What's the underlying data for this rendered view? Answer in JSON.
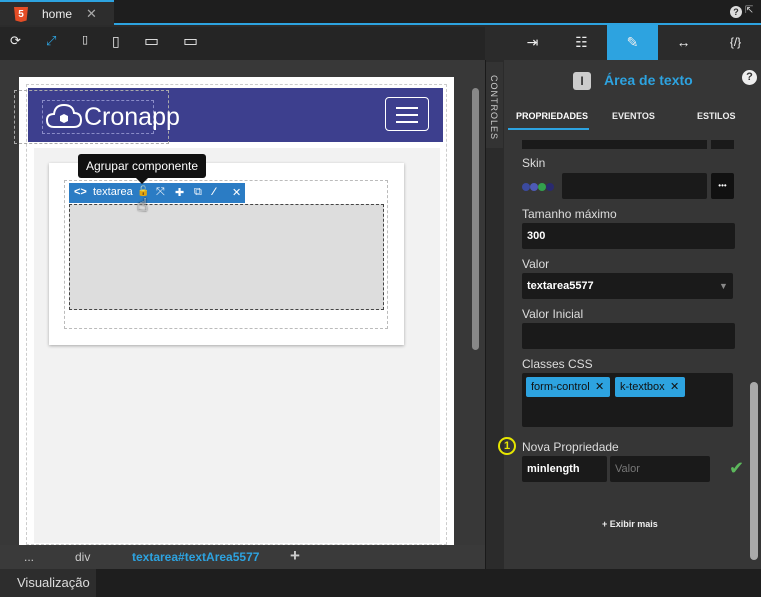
{
  "tab": {
    "badge": "5",
    "title": "home",
    "close": "✕"
  },
  "topright": {
    "help": "?",
    "ext": "⇱"
  },
  "toolbar": {
    "refresh": "⟳",
    "fit": "⤢",
    "mobile": "▯",
    "tablet": "▯",
    "desktop": "▭",
    "wide": "▭"
  },
  "navbar": {
    "logo": "Cronapp"
  },
  "component": {
    "tag_icon": "<>",
    "name": "textarea",
    "lock": "🔓",
    "move": "⤧",
    "add": "✚",
    "copy": "⧉",
    "wand": "⁄",
    "close": "✕",
    "tooltip": "Agrupar componente",
    "cursor": "☝"
  },
  "breadcrumb": {
    "items": [
      "...",
      "div",
      "textarea#textArea5577"
    ],
    "add": "+"
  },
  "bottom": {
    "tab": "Visualização"
  },
  "side": {
    "label": "CONTROLES"
  },
  "panel": {
    "tabs": [
      "⇥",
      "☷",
      "✎",
      "↔",
      "{/}"
    ],
    "title": "Área de texto",
    "icon": "I",
    "help": "?",
    "subtabs": [
      "PROPRIEDADES",
      "EVENTOS",
      "ESTILOS"
    ],
    "skin_label": "Skin",
    "skin_more": "•••",
    "max_label": "Tamanho máximo",
    "max_value": "300",
    "value_label": "Valor",
    "value_value": "textarea5577",
    "initial_label": "Valor Inicial",
    "css_label": "Classes CSS",
    "css_classes": [
      "form-control",
      "k-textbox"
    ],
    "chip_x": "✕",
    "new_label": "Nova Propriedade",
    "new_name": "minlength",
    "new_value_placeholder": "Valor",
    "callout": "1",
    "confirm": "✔",
    "more": "+ Exibir mais",
    "skin_colors": [
      "#3b4a9e",
      "#4d5ab5",
      "#33a04d",
      "#2a2a6e"
    ]
  }
}
